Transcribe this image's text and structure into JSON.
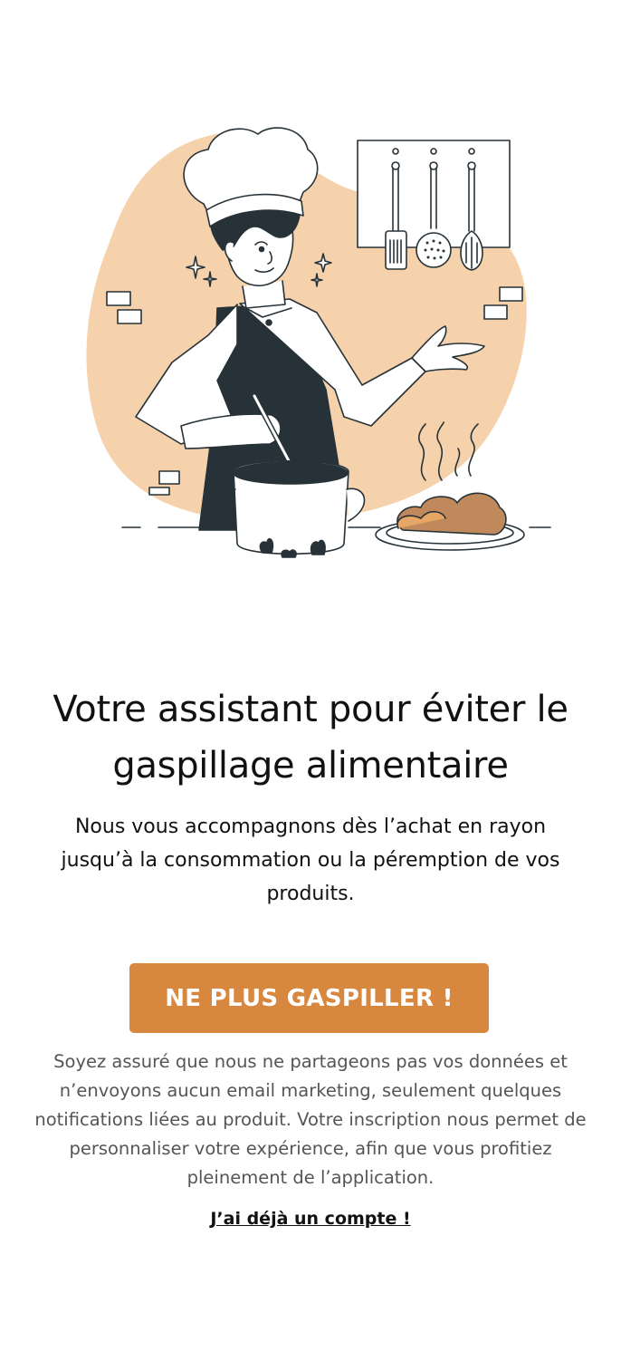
{
  "hero": {
    "illustration": "chef-cooking-illustration",
    "accent_color": "#f5d2ac"
  },
  "content": {
    "title": "Votre assistant pour éviter le gaspillage alimentaire",
    "subtitle": "Nous vous accompagnons dès l’achat en rayon jusqu’à la consommation ou la péremption de vos produits."
  },
  "cta": {
    "label": "NE PLUS GASPILLER !",
    "color": "#d8873f"
  },
  "privacy": {
    "text": "Soyez assuré que nous ne partageons pas vos données et n’envoyons aucun email marketing, seulement quelques notifications liées au produit. Votre inscription nous permet de personnaliser votre expérience, afin que vous profitiez pleinement de l’application."
  },
  "login": {
    "label": "J’ai déjà un compte !"
  }
}
